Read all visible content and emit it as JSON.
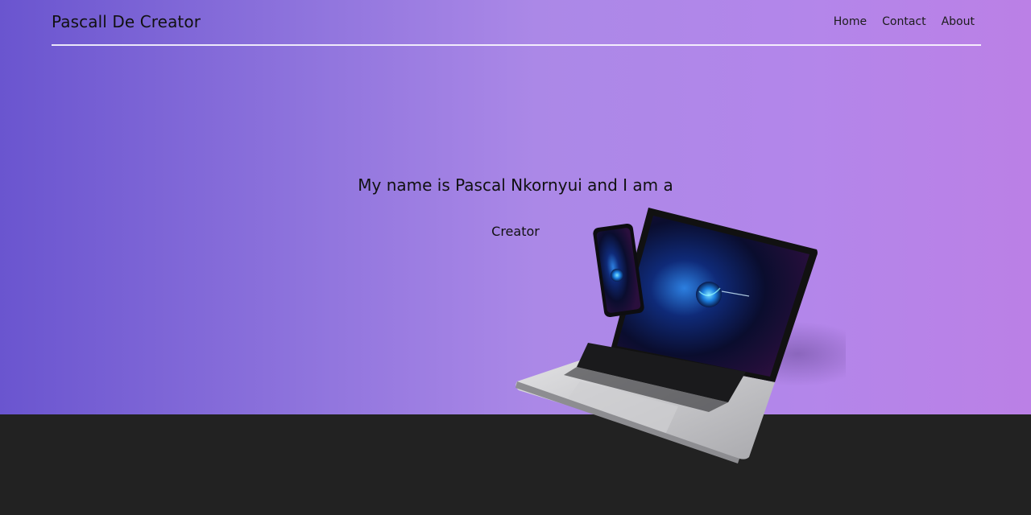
{
  "header": {
    "brand": "Pascall De Creator",
    "nav": [
      {
        "label": "Home"
      },
      {
        "label": "Contact"
      },
      {
        "label": "About"
      }
    ]
  },
  "hero": {
    "headline": "My name is Pascal Nkornyui and I am a",
    "role": "Creator",
    "image": "laptop-and-phone-mockup"
  },
  "colors": {
    "gradient_start": "#6a55cf",
    "gradient_mid": "#ab88e7",
    "gradient_end": "#bb80e6",
    "footer_background": "#222222"
  }
}
